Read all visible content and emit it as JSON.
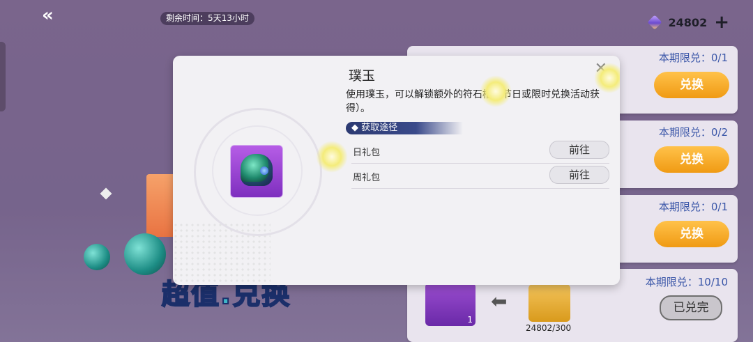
{
  "header": {
    "timer_text": "剩余时间：5天13小时",
    "currency_value": "24802"
  },
  "cards": [
    {
      "limit": "本期限兑：0/1",
      "button": "兑换"
    },
    {
      "limit": "本期限兑：0/2",
      "button": "兑换"
    },
    {
      "limit": "本期限兑：0/1",
      "button": "兑换"
    },
    {
      "limit": "本期限兑：10/10",
      "button": "已兑完",
      "item_count": "1",
      "cost": "24802/300"
    }
  ],
  "modal": {
    "title": "璞玉",
    "description": "使用璞玉，可以解锁额外的符石槽（节日或限时兑换活动获得）。",
    "section_label": "获取途径",
    "sources": [
      {
        "label": "日礼包",
        "button": "前往"
      },
      {
        "label": "周礼包",
        "button": "前往"
      }
    ]
  },
  "banner_text": "超值.兑换",
  "colors": {
    "exchange_button": "#f09a13",
    "limit_text": "#3a56a8",
    "section_bg": "#2c3a72"
  }
}
